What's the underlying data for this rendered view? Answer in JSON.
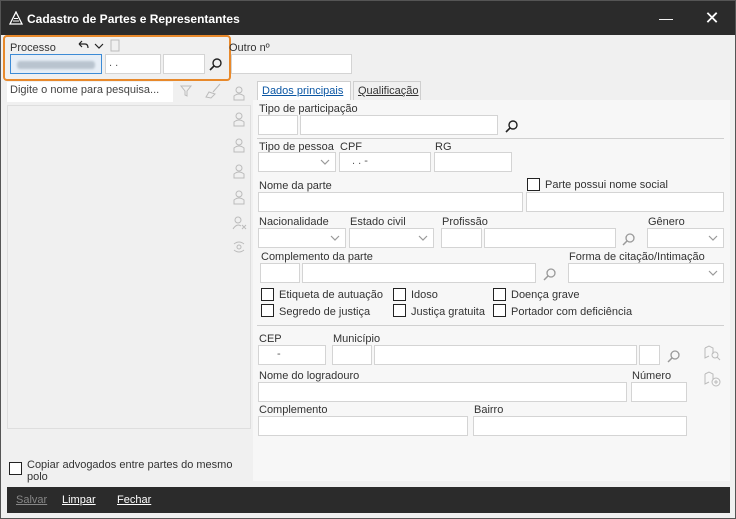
{
  "window": {
    "title": "Cadastro de Partes e Representantes",
    "minimize_symbol": "—",
    "close_symbol": "✕"
  },
  "processo": {
    "label": "Processo",
    "field2_value": ". .",
    "outro_label": "Outro nº"
  },
  "search": {
    "placeholder": "Digite o nome para pesquisa..."
  },
  "tabs": [
    {
      "label": "Dados principais",
      "active": true
    },
    {
      "label": "Qualificação",
      "active": false
    }
  ],
  "form": {
    "tipo_participacao": "Tipo de participação",
    "tipo_pessoa": "Tipo de pessoa",
    "cpf_label": "CPF",
    "cpf_value": ". . -",
    "rg_label": "RG",
    "nome_parte": "Nome da parte",
    "nome_social": "Parte possui nome social",
    "nacionalidade": "Nacionalidade",
    "estado_civil": "Estado civil",
    "profissao": "Profissão",
    "genero": "Gênero",
    "complemento_parte": "Complemento da parte",
    "forma_citacao": "Forma de citação/Intimação",
    "checkboxes": [
      "Etiqueta de autuação",
      "Idoso",
      "Doença grave",
      "Segredo de justiça",
      "Justiça gratuita",
      "Portador com deficiência"
    ],
    "cep_label": "CEP",
    "cep_value": "-",
    "municipio": "Município",
    "logradouro": "Nome do logradouro",
    "numero": "Número",
    "complemento": "Complemento",
    "bairro": "Bairro"
  },
  "bottom": {
    "copiar": "Copiar advogados entre partes do mesmo polo"
  },
  "footer": {
    "salvar": "Salvar",
    "limpar": "Limpar",
    "fechar": "Fechar"
  },
  "colors": {
    "accent_orange": "#e8892b",
    "titlebar": "#2b2b2b",
    "tab_active_text": "#0b57a4"
  }
}
